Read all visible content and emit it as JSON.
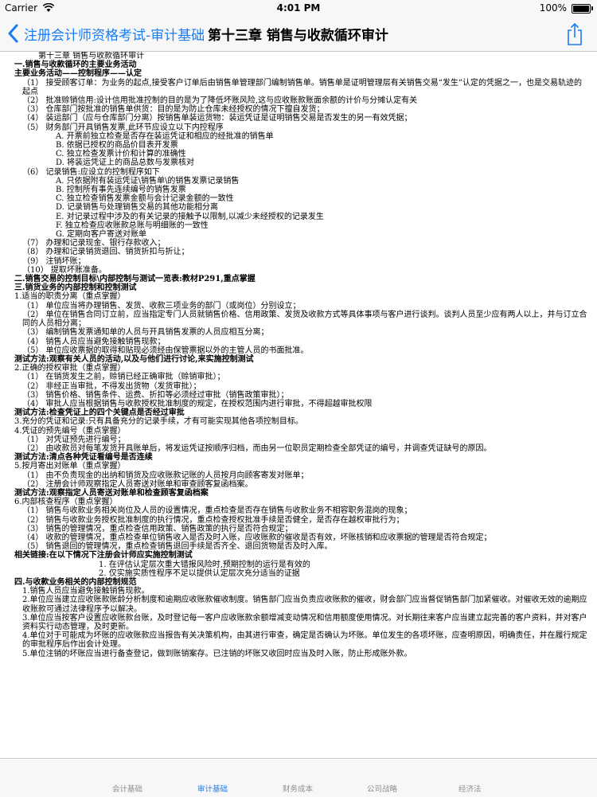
{
  "status_bar": {
    "carrier": "Carrier",
    "time": "4:01 PM",
    "battery": "100%"
  },
  "nav": {
    "back_label": "注册会计师资格考试-审计基础",
    "title": "第十三章  销售与收款循环审计"
  },
  "document": {
    "lines": [
      {
        "text": "第十三章  销售与收款循环审计",
        "style": "title"
      },
      {
        "text": "一.销售与收款循环的主要业务活动",
        "style": "b"
      },
      {
        "text": "主要业务活动——控制程序——认定",
        "style": "b"
      },
      {
        "text": "（1） 接受顾客订单：为业务的起点,接受客户订单后由销售单管理部门编制销售单。销售单是证明管理层有关销售交易“发生”认定的凭据之一，也是交易轨迹的起点",
        "style": "i1"
      },
      {
        "text": "（2） 批准赊销信用:设计信用批准控制的目的是为了降低坏账风险,这与应收账款账面余额的计价与分摊认定有关",
        "style": "i1"
      },
      {
        "text": "（3） 仓库部门按批准的销售单供货：目的是为防止仓库未经授权的情况下擅自发货；",
        "style": "i1"
      },
      {
        "text": "（4） 装运部门（应与仓库部门分离）按销售单装运货物：装运凭证是证明销售交易是否发生的另一有效凭据；",
        "style": "i1"
      },
      {
        "text": "（5） 财务部门开具销售发票,此环节应设立以下内控程序",
        "style": "i1"
      },
      {
        "text": "A. 开票前独立检查是否存在装运凭证和相应的经批准的销售单",
        "style": "i2"
      },
      {
        "text": "B. 依据已授权的商品价目表开发票",
        "style": "i2"
      },
      {
        "text": "C. 独立检查发票计价和计算的准确性",
        "style": "i2"
      },
      {
        "text": "D. 将装运凭证上的商品总数与发票核对",
        "style": "i2"
      },
      {
        "text": "（6） 记录销售:应设立的控制程序如下",
        "style": "i1"
      },
      {
        "text": "A. 只依据附有装运凭证\\销售单\\的销售发票记录销售",
        "style": "i2"
      },
      {
        "text": "B. 控制所有事先连续编号的销售发票",
        "style": "i2"
      },
      {
        "text": "C. 独立检查销售发票金额与会计记录金额的一致性",
        "style": "i2"
      },
      {
        "text": "D. 记录销售与处理销售交易的其他功能相分离",
        "style": "i2"
      },
      {
        "text": "E. 对记录过程中涉及的有关记录的接触予以限制,以减少未经授权的记录发生",
        "style": "i2"
      },
      {
        "text": "F. 独立检查应收账款总账与明细账的一致性",
        "style": "i2"
      },
      {
        "text": "G. 定期向客户寄送对账单",
        "style": "i2"
      },
      {
        "text": "（7） 办理和记录现金、银行存款收入；",
        "style": "i1"
      },
      {
        "text": "（8） 办理和记录销货退回、销货折扣与折让；",
        "style": "i1"
      },
      {
        "text": "（9） 注销坏账；",
        "style": "i1"
      },
      {
        "text": "（10） 提取坏账准备。",
        "style": "i1"
      },
      {
        "text": "二.销售交易的控制目标\\内部控制与测试一览表:教材P291,重点掌握",
        "style": "b"
      },
      {
        "text": "三.销货业务的内部控制和控制测试",
        "style": "b"
      },
      {
        "text": "1.适当的职责分离（重点掌握）",
        "style": ""
      },
      {
        "text": "（1） 单位应当将办理销售、发货、收款三项业务的部门（或岗位）分别设立；",
        "style": "i1"
      },
      {
        "text": "（2） 单位在销售合同订立前，应当指定专门人员就销售价格、信用政策、发货及收款方式等具体事项与客户进行谈判。谈判人员至少应有两人以上，并与订立合同的人员相分离；",
        "style": "i1"
      },
      {
        "text": "（3） 编制销售发票通知单的人员与开具销售发票的人员应相互分离；",
        "style": "i1"
      },
      {
        "text": "（4） 销售人员应当避免接触销售现款；",
        "style": "i1"
      },
      {
        "text": "（5） 单位应收票据的取得和贴现必须经由保管票据以外的主管人员的书面批准。",
        "style": "i1"
      },
      {
        "text": "测试方法:观察有关人员的活动,以及与他们进行讨论,来实施控制测试",
        "style": "b"
      },
      {
        "text": "2.正确的授权审批（重点掌握）",
        "style": ""
      },
      {
        "text": "（1） 在销货发生之前，赊销已经正确审批（赊销审批）；",
        "style": "i1"
      },
      {
        "text": "（2） 非经正当审批，不得发出货物（发货审批）；",
        "style": "i1"
      },
      {
        "text": "（3） 销售价格、销售条件、运费、折扣等必须经过审批（销售政策审批）；",
        "style": "i1"
      },
      {
        "text": "（4） 审批人应当根据销售与收款授权批准制度的规定，在授权范围内进行审批，不得超越审批权限",
        "style": "i1"
      },
      {
        "text": "测试方法:检查凭证上的四个关键点是否经过审批",
        "style": "b"
      },
      {
        "text": "3.充分的凭证和记录:只有具备充分的记录手续，才有可能实现其他各项控制目标。",
        "style": ""
      },
      {
        "text": "4.凭证的预先编号（重点掌握）",
        "style": ""
      },
      {
        "text": "（1） 对凭证预先进行编号；",
        "style": "i1"
      },
      {
        "text": "（2） 由收款员对每笔发货开具账单后，将发运凭证按顺序归档，而由另一位职员定期检查全部凭证的编号，并调查凭证缺号的原因。",
        "style": "i1"
      },
      {
        "text": "测试方法:清点各种凭证看编号是否连续",
        "style": "b"
      },
      {
        "text": "5.按月寄出对账单（重点掌握）",
        "style": ""
      },
      {
        "text": "（1） 由不负责现金的出纳和销货及应收账款记账的人员按月向顾客寄发对账单；",
        "style": "i1"
      },
      {
        "text": "（2） 注册会计师观察指定人员寄送对账单和审查顾客复函档案。",
        "style": "i1"
      },
      {
        "text": "测试方法:观察指定人员寄送对账单和检查顾客复函档案",
        "style": "b"
      },
      {
        "text": "6.内部核查程序（重点掌握）",
        "style": ""
      },
      {
        "text": "（1） 销售与收款业务相关岗位及人员的设置情况，重点检查是否存在销售与收款业务不相容职务混岗的现象；",
        "style": "i1"
      },
      {
        "text": "（2） 销售与收款业务授权批准制度的执行情况，重点检查授权批准手续是否健全，是否存在越权审批行为；",
        "style": "i1"
      },
      {
        "text": "（3） 销售的管理情况，重点检查信用政策、销售政策的执行是否符合规定；",
        "style": "i1"
      },
      {
        "text": "（4） 收款的管理情况，重点检查单位销售收入是否及时入账，应收账款的催收是否有效，坏账核销和应收票据的管理是否符合规定；",
        "style": "i1"
      },
      {
        "text": "（5） 销售退回的管理情况，重点检查销售退回手续是否齐全、退回货物是否及时入库。",
        "style": "i1"
      },
      {
        "text": "相关链接:在以下情况下注册会计师应实施控制测试",
        "style": "b"
      },
      {
        "text": "1. 在评估认定层次重大错报风险时,预期控制的运行是有效的",
        "style": "i3"
      },
      {
        "text": "2. 仅实施实质性程序不足以提供认定层次充分适当的证据",
        "style": "i3"
      },
      {
        "text": "四.与收款业务相关的内部控制规范",
        "style": "b"
      },
      {
        "text": "1.销售人员应当避免接触销售现款。",
        "style": "i1"
      },
      {
        "text": "2.单位应当建立应收账款账龄分析制度和逾期应收账款催收制度。销售部门应当负责应收账款的催收，财会部门应当督促销售部门加紧催收。对催收无效的逾期应收账款可通过法律程序予以解决。",
        "style": "i1"
      },
      {
        "text": "3.单位应当按客户设置应收账款台账，及时登记每一客户应收账款余额增减变动情况和信用额度使用情况。对长期往来客户应当建立起完善的客户资料，并对客户资料实行动态管理，及时更新。",
        "style": "i1"
      },
      {
        "text": "4.单位对于可能成为坏账的应收账款应当报告有关决策机构，由其进行审查，确定是否确认为坏账。单位发生的各项坏账，应查明原因，明确责任，并在履行规定的审批程序后作出会计处理。",
        "style": "i1"
      },
      {
        "text": "5.单位注销的坏账应当进行备查登记，做到账销案存。已注销的坏账又收回时应当及时入账，防止形成账外款。",
        "style": "i1"
      }
    ]
  },
  "tabs": [
    {
      "label": "会计基础",
      "active": false
    },
    {
      "label": "审计基础",
      "active": true
    },
    {
      "label": "财务成本",
      "active": false
    },
    {
      "label": "公司战略",
      "active": false
    },
    {
      "label": "经济法",
      "active": false
    }
  ],
  "colors": {
    "accent": "#1a7cf5",
    "inactive_tab": "#8e8e93"
  }
}
